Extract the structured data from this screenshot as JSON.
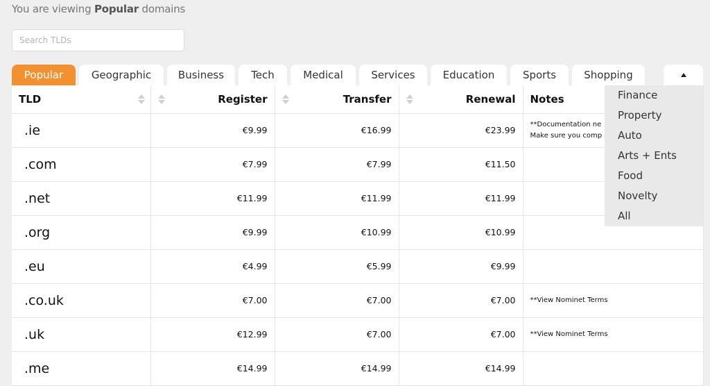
{
  "header": {
    "viewing_prefix": "You are viewing ",
    "viewing_category": "Popular",
    "viewing_suffix": " domains"
  },
  "search": {
    "placeholder": "Search TLDs",
    "value": ""
  },
  "tabs": [
    {
      "label": "Popular",
      "active": true
    },
    {
      "label": "Geographic",
      "active": false
    },
    {
      "label": "Business",
      "active": false
    },
    {
      "label": "Tech",
      "active": false
    },
    {
      "label": "Medical",
      "active": false
    },
    {
      "label": "Services",
      "active": false
    },
    {
      "label": "Education",
      "active": false
    },
    {
      "label": "Sports",
      "active": false
    },
    {
      "label": "Shopping",
      "active": false
    }
  ],
  "more_tab_icon": "triangle-up-icon",
  "dropdown": {
    "items": [
      "Finance",
      "Property",
      "Auto",
      "Arts + Ents",
      "Food",
      "Novelty",
      "All"
    ]
  },
  "table": {
    "columns": {
      "tld": "TLD",
      "register": "Register",
      "transfer": "Transfer",
      "renewal": "Renewal",
      "notes": "Notes"
    },
    "rows": [
      {
        "tld": ".ie",
        "register": "€9.99",
        "transfer": "€16.99",
        "renewal": "€23.99",
        "note1": "**Documentation ne",
        "note2": "Make sure you comp"
      },
      {
        "tld": ".com",
        "register": "€7.99",
        "transfer": "€7.99",
        "renewal": "€11.50",
        "note1": "",
        "note2": ""
      },
      {
        "tld": ".net",
        "register": "€11.99",
        "transfer": "€11.99",
        "renewal": "€11.99",
        "note1": "",
        "note2": ""
      },
      {
        "tld": ".org",
        "register": "€9.99",
        "transfer": "€10.99",
        "renewal": "€10.99",
        "note1": "",
        "note2": ""
      },
      {
        "tld": ".eu",
        "register": "€4.99",
        "transfer": "€5.99",
        "renewal": "€9.99",
        "note1": "",
        "note2": ""
      },
      {
        "tld": ".co.uk",
        "register": "€7.00",
        "transfer": "€7.00",
        "renewal": "€7.00",
        "note1": "**View Nominet Terms",
        "note2": ""
      },
      {
        "tld": ".uk",
        "register": "€12.99",
        "transfer": "€7.00",
        "renewal": "€7.00",
        "note1": "**View Nominet Terms",
        "note2": ""
      },
      {
        "tld": ".me",
        "register": "€14.99",
        "transfer": "€14.99",
        "renewal": "€14.99",
        "note1": "",
        "note2": ""
      }
    ]
  },
  "colors": {
    "accent": "#f39130",
    "background": "#efefef",
    "dropdown_bg": "#e9e9e9"
  }
}
